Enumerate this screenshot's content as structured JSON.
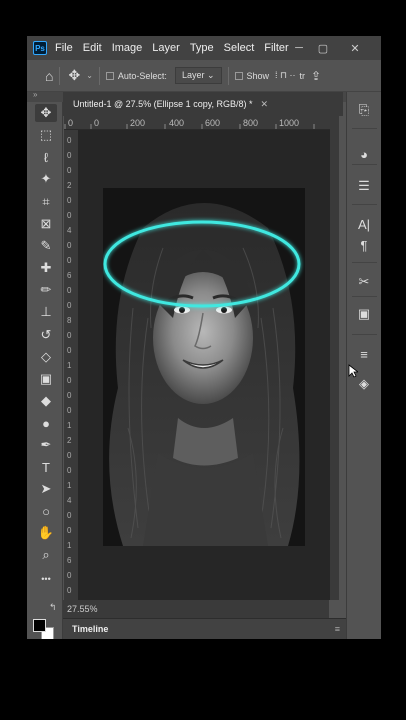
{
  "app": {
    "logo": "Ps",
    "menu": [
      "File",
      "Edit",
      "Image",
      "Layer",
      "Type",
      "Select",
      "Filter"
    ],
    "window_controls": [
      "minimize",
      "restore",
      "close"
    ]
  },
  "options_bar": {
    "auto_select_label": "Auto-Select:",
    "layer_select": "Layer",
    "show_label": "Show",
    "truncated": "tr"
  },
  "document": {
    "tab_title": "Untitled-1 @ 27.5% (Ellipse 1 copy, RGB/8) *",
    "zoom_status": "27.55%"
  },
  "ruler": {
    "h_ticks": [
      "0",
      "0",
      "200",
      "400",
      "600",
      "800",
      "1000"
    ],
    "v_ticks": [
      "0",
      "0",
      "0",
      "2",
      "0",
      "0",
      "4",
      "0",
      "0",
      "6",
      "0",
      "0",
      "8",
      "0",
      "0",
      "1",
      "0",
      "0",
      "0",
      "1",
      "2",
      "0",
      "0",
      "1",
      "4",
      "0",
      "0",
      "1",
      "6",
      "0",
      "0"
    ]
  },
  "toolbar": {
    "tools": [
      {
        "name": "move-tool",
        "glyph": "✥"
      },
      {
        "name": "marquee-tool",
        "glyph": "⬚"
      },
      {
        "name": "lasso-tool",
        "glyph": "ℓ"
      },
      {
        "name": "magic-wand-tool",
        "glyph": "✦"
      },
      {
        "name": "crop-tool",
        "glyph": "⌗"
      },
      {
        "name": "frame-tool",
        "glyph": "⊠"
      },
      {
        "name": "eyedropper-tool",
        "glyph": "✎"
      },
      {
        "name": "healing-brush-tool",
        "glyph": "✚"
      },
      {
        "name": "brush-tool",
        "glyph": "✏"
      },
      {
        "name": "clone-stamp-tool",
        "glyph": "⊥"
      },
      {
        "name": "history-brush-tool",
        "glyph": "↺"
      },
      {
        "name": "eraser-tool",
        "glyph": "◇"
      },
      {
        "name": "gradient-tool",
        "glyph": "▣"
      },
      {
        "name": "blur-tool",
        "glyph": "◆"
      },
      {
        "name": "dodge-tool",
        "glyph": "●"
      },
      {
        "name": "pen-tool",
        "glyph": "✒"
      },
      {
        "name": "type-tool",
        "glyph": "T"
      },
      {
        "name": "path-selection-tool",
        "glyph": "➤"
      },
      {
        "name": "ellipse-tool",
        "glyph": "○"
      },
      {
        "name": "hand-tool",
        "glyph": "✋"
      },
      {
        "name": "zoom-tool",
        "glyph": "⌕"
      },
      {
        "name": "more-tools",
        "glyph": "•••"
      }
    ]
  },
  "panels": {
    "icons": [
      {
        "name": "history-panel-icon",
        "glyph": "⎘"
      },
      {
        "name": "color-panel-icon",
        "glyph": "◕"
      },
      {
        "name": "libraries-panel-icon",
        "glyph": "☰"
      },
      {
        "name": "character-panel-icon",
        "glyph": "A|"
      },
      {
        "name": "paragraph-panel-icon",
        "glyph": "¶"
      },
      {
        "name": "tools-panel-icon",
        "glyph": "✂"
      },
      {
        "name": "properties-panel-icon",
        "glyph": "▣"
      },
      {
        "name": "adjustments-panel-icon",
        "glyph": "≡"
      },
      {
        "name": "layers-panel-icon",
        "glyph": "◈"
      }
    ]
  },
  "timeline": {
    "label": "Timeline"
  },
  "colors": {
    "app_bg": "#535353",
    "canvas_bg": "#262626",
    "halo": "#3fe8e0"
  }
}
